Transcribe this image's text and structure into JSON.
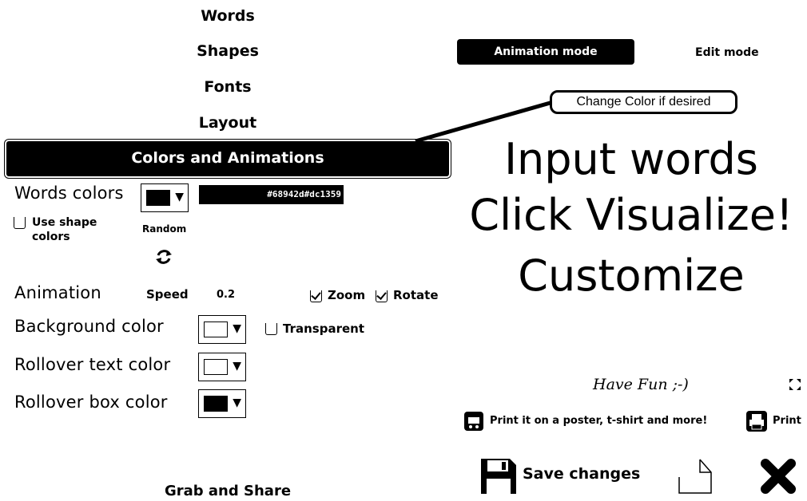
{
  "menu": {
    "words": "Words",
    "shapes": "Shapes",
    "fonts": "Fonts",
    "layout": "Layout",
    "colors_animations": "Colors and Animations"
  },
  "colors_panel": {
    "words_colors_label": "Words colors",
    "words_color_hex": "#68942d#dc1359",
    "use_shape_colors_label": "Use shape colors",
    "random_label": "Random",
    "animation_label": "Animation",
    "speed_label": "Speed",
    "speed_value": "0.2",
    "zoom_label": "Zoom",
    "zoom_checked": true,
    "rotate_label": "Rotate",
    "rotate_checked": true,
    "background_color_label": "Background color",
    "transparent_label": "Transparent",
    "rollover_text_color_label": "Rollover text color",
    "rollover_box_color_label": "Rollover box color",
    "swatch_colors": {
      "words": "#000000",
      "background": "#ffffff",
      "rollover_text": "#ffffff",
      "rollover_box": "#000000"
    }
  },
  "modes": {
    "animation_mode": "Animation mode",
    "edit_mode": "Edit mode"
  },
  "callout": "Change Color if desired",
  "canvas_text": {
    "line1": "Input words",
    "line2": "Click Visualize!",
    "line3": "Customize"
  },
  "have_fun": "Have Fun ;-)",
  "print_poster": "Print it on a poster, t-shirt and more!",
  "print": "Print",
  "save_changes": "Save changes",
  "grab_share": "Grab and Share",
  "icons": [
    "refresh-icon",
    "fullscreen-icon",
    "cart-icon",
    "printer-icon",
    "save-disk-icon",
    "new-document-icon",
    "close-icon"
  ]
}
